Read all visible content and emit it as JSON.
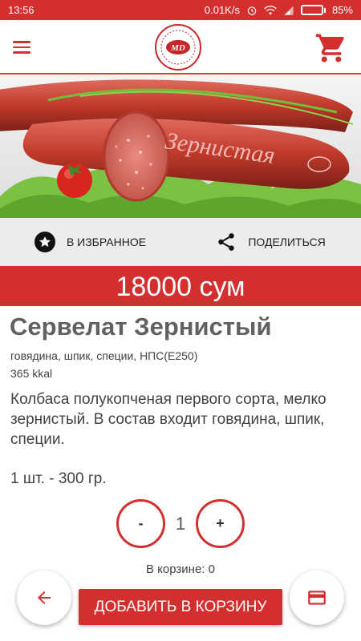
{
  "status_bar": {
    "time": "13:56",
    "network_speed": "0.01K/s",
    "battery_percent": "85%",
    "battery_level": 0.85,
    "icons": [
      "alarm-icon",
      "wifi-icon",
      "signal-icon",
      "battery-icon"
    ]
  },
  "app_bar": {
    "menu_icon": "menu-icon",
    "logo_text": "MD",
    "cart_icon": "cart-icon"
  },
  "hero": {
    "image_text": "Зернистая"
  },
  "actions": {
    "favorite_label": "В ИЗБРАННОЕ",
    "favorite_icon": "star-icon",
    "share_label": "ПОДЕЛИТЬСЯ",
    "share_icon": "share-icon"
  },
  "product": {
    "price": "18000 сум",
    "title": "Сервелат Зернистый",
    "ingredients": "говядина, шпик, специи, НПС(Е250)",
    "kcal": "365 kkal",
    "description": "Колбаса полукопченая первого сорта, мелко зернистый. В состав входит говядина, шпик, специи.",
    "portion": "1 шт. - 300 гр."
  },
  "quantity": {
    "minus_label": "-",
    "value": "1",
    "plus_label": "+",
    "in_cart": "В корзине: 0"
  },
  "bottom": {
    "back_icon": "arrow-left-icon",
    "add_to_cart_label": "ДОБАВИТЬ В КОРЗИНУ",
    "card_icon": "credit-card-icon"
  },
  "colors": {
    "primary": "#d32f2f",
    "background_light": "#ececec",
    "text_gray": "#616161"
  }
}
